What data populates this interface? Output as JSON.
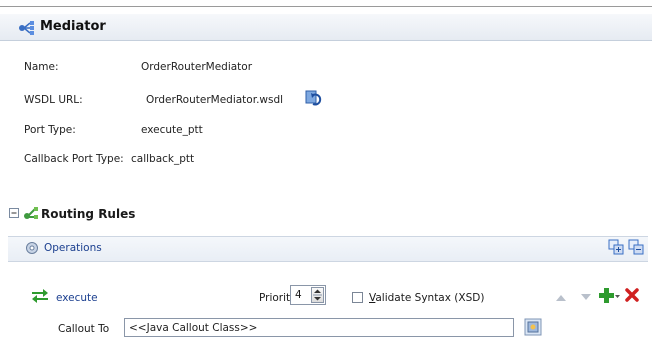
{
  "mediator": {
    "title": "Mediator",
    "fields": [
      {
        "label": "Name:",
        "value": "OrderRouterMediator"
      },
      {
        "label": "WSDL URL:",
        "value": "OrderRouterMediator.wsdl"
      },
      {
        "label": "Port Type:",
        "value": "execute_ptt"
      },
      {
        "label": "Callback Port Type:",
        "value": "callback_ptt"
      }
    ],
    "wsdl_button_icon": "refresh-wsdl-icon"
  },
  "routing_rules": {
    "title": "Routing Rules",
    "collapse_icon": "collapse-minus-icon",
    "section_icon": "routing-rules-icon",
    "operations_label": "Operations",
    "expand_all_icon": "expand-all-icon",
    "collapse_all_icon": "collapse-all-icon",
    "operation": {
      "name": "execute",
      "priority_label": "Priority",
      "priority_value": "4",
      "validate_label": "Validate Syntax (XSD)",
      "validate_underline_char": "V",
      "validate_rest": "alidate Syntax (XSD)",
      "validate_checked": false
    },
    "callout_label": "Callout To",
    "callout_value": "<<Java Callout Class>>",
    "browse_icon": "browse-class-icon"
  },
  "colors": {
    "link": "#1b3f8f",
    "add": "#2e9b2e",
    "delete": "#d02020",
    "header_band": "#e6ebf2"
  }
}
